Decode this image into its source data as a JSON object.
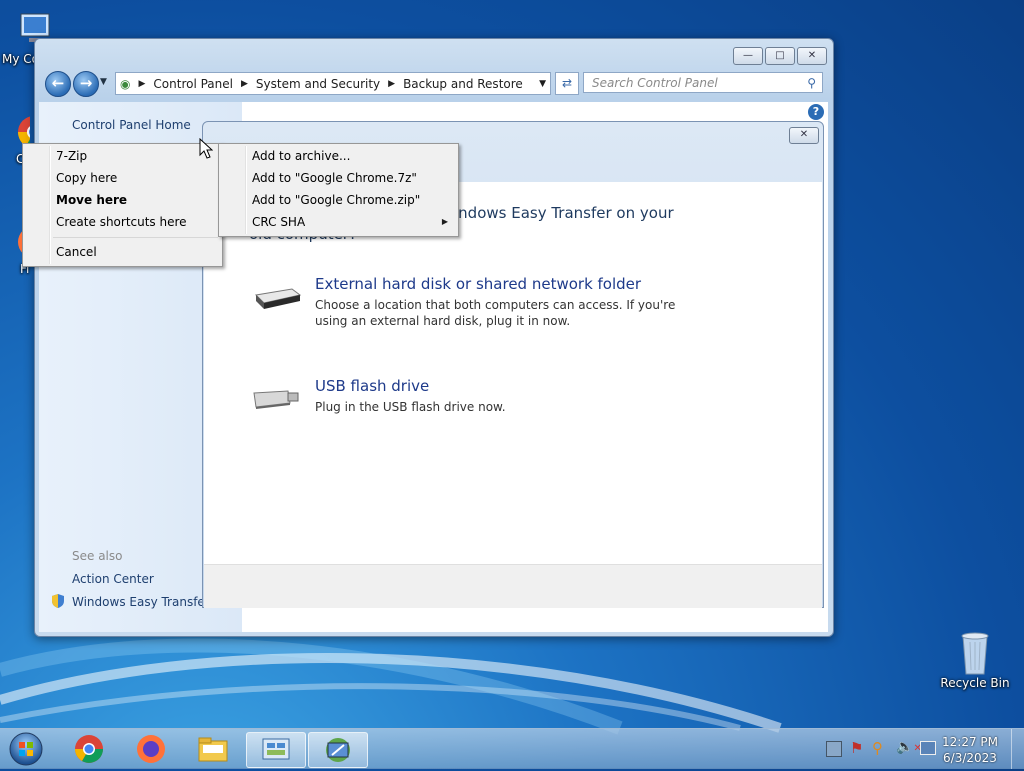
{
  "desktop": {
    "icons": [
      {
        "label": "My Co"
      },
      {
        "label": "C"
      },
      {
        "label": "C"
      },
      {
        "label": "Fi"
      },
      {
        "label": "Recycle Bin"
      }
    ]
  },
  "window": {
    "breadcrumb": [
      "Control Panel",
      "System and Security",
      "Backup and Restore"
    ],
    "search_placeholder": "Search Control Panel",
    "sidebar": {
      "home": "Control Panel Home",
      "see_also": "See also",
      "links": [
        "Action Center",
        "Windows Easy Transfer"
      ]
    }
  },
  "dialog": {
    "heading": "indows Easy Transfer on your old computer?",
    "options": [
      {
        "title": "External hard disk or shared network folder",
        "desc": "Choose a location that both computers can access. If you're using an external hard disk, plug it in now."
      },
      {
        "title": "USB flash drive",
        "desc": "Plug in the USB flash drive now."
      }
    ]
  },
  "context_menu": {
    "items": [
      "7-Zip",
      "Copy here",
      "Move here",
      "Create shortcuts here",
      "Cancel"
    ]
  },
  "submenu": {
    "items": [
      "Add to archive...",
      "Add to \"Google Chrome.7z\"",
      "Add to \"Google Chrome.zip\"",
      "CRC SHA"
    ]
  },
  "taskbar": {
    "time": "12:27 PM",
    "date": "6/3/2023"
  }
}
